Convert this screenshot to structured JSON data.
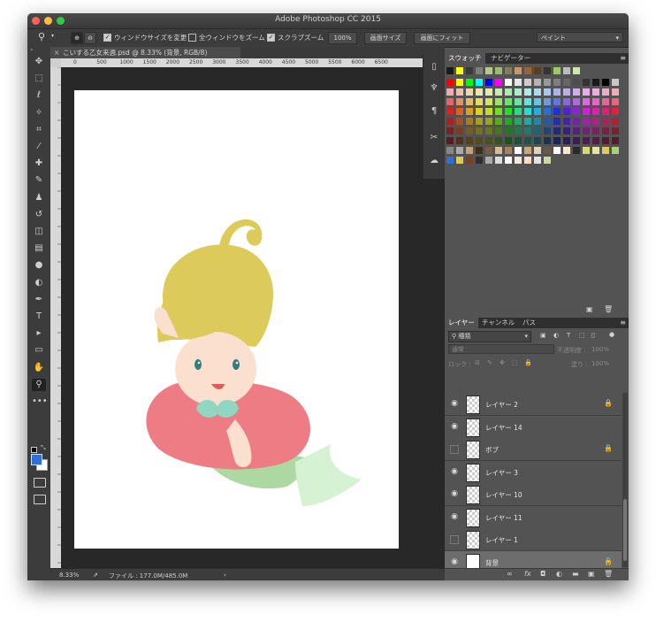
{
  "window": {
    "title": "Adobe Photoshop CC 2015"
  },
  "options_bar": {
    "resize_windows_label": "ウィンドウサイズを変更",
    "resize_windows_checked": true,
    "zoom_all_label": "全ウィンドウをズーム",
    "zoom_all_checked": false,
    "scrubby_zoom_label": "スクラブズーム",
    "scrubby_zoom_checked": true,
    "zoom_value": "100%",
    "fit_screen_label": "画面サイズ",
    "fill_screen_label": "画面にフィット",
    "workspace_value": "ペイント"
  },
  "document": {
    "tab_label": "こいする乙女来週.psd @ 8.33% (背景, RGB/8)",
    "close_glyph": "×",
    "ruler_ticks": [
      "0",
      "500",
      "1000",
      "1500",
      "2000",
      "2500",
      "3000",
      "3500",
      "4000",
      "4500",
      "5000",
      "5500",
      "6000",
      "6500"
    ]
  },
  "status": {
    "zoom": "8.33%",
    "file_info": "ファイル : 177.0M/485.0M",
    "arrow": "›"
  },
  "tools": [
    {
      "name": "move-tool",
      "glyph": "✥"
    },
    {
      "name": "marquee-tool",
      "glyph": "⬚"
    },
    {
      "name": "lasso-tool",
      "glyph": "ℓ"
    },
    {
      "name": "magic-wand-tool",
      "glyph": "✧"
    },
    {
      "name": "crop-tool",
      "glyph": "⌗"
    },
    {
      "name": "eyedropper-tool",
      "glyph": "⁄"
    },
    {
      "name": "healing-brush-tool",
      "glyph": "✚"
    },
    {
      "name": "brush-tool",
      "glyph": "✎"
    },
    {
      "name": "clone-stamp-tool",
      "glyph": "♟"
    },
    {
      "name": "history-brush-tool",
      "glyph": "↺"
    },
    {
      "name": "eraser-tool",
      "glyph": "◫"
    },
    {
      "name": "gradient-tool",
      "glyph": "▤"
    },
    {
      "name": "blur-tool",
      "glyph": "●"
    },
    {
      "name": "dodge-tool",
      "glyph": "◐"
    },
    {
      "name": "pen-tool",
      "glyph": "✒"
    },
    {
      "name": "type-tool",
      "glyph": "T"
    },
    {
      "name": "path-selection-tool",
      "glyph": "▸"
    },
    {
      "name": "rectangle-tool",
      "glyph": "▭"
    },
    {
      "name": "hand-tool",
      "glyph": "✋"
    },
    {
      "name": "zoom-tool",
      "glyph": "⚲"
    },
    {
      "name": "edit-toolbar",
      "glyph": "•••"
    }
  ],
  "swatches_panel": {
    "tabs": [
      "スウォッチ",
      "ナビゲーター"
    ]
  },
  "layers_panel": {
    "tabs": [
      "レイヤー",
      "チャンネル",
      "パス"
    ],
    "filter_label": "種類",
    "blend_mode": "通常",
    "opacity_label": "不透明度 :",
    "opacity_value": "100%",
    "lock_label": "ロック :",
    "fill_label": "塗り :",
    "fill_value": "100%",
    "layers": [
      {
        "name": "レイヤー 2",
        "visible": true,
        "locked": true,
        "active": false,
        "thumb": "check"
      },
      {
        "name": "レイヤー 14",
        "visible": true,
        "locked": false,
        "active": false,
        "thumb": "check"
      },
      {
        "name": "ボブ",
        "visible": false,
        "locked": true,
        "active": false,
        "thumb": "check"
      },
      {
        "name": "レイヤー 3",
        "visible": true,
        "locked": false,
        "active": false,
        "thumb": "check"
      },
      {
        "name": "レイヤー 10",
        "visible": true,
        "locked": false,
        "active": false,
        "thumb": "check"
      },
      {
        "name": "レイヤー 11",
        "visible": true,
        "locked": false,
        "active": false,
        "thumb": "check"
      },
      {
        "name": "レイヤー 1",
        "visible": false,
        "locked": false,
        "active": false,
        "thumb": "check"
      },
      {
        "name": "背景",
        "visible": true,
        "locked": true,
        "active": true,
        "thumb": "white"
      }
    ]
  },
  "colors": {
    "foreground": "#2f6fd6",
    "background": "#ffffff",
    "hair": "#dccb5a",
    "skin": "#fce0cf",
    "float_ring": "#ee7c84",
    "shell": "#8fd7c1",
    "tail": "#aed8a2",
    "fin": "#d5f3d2"
  }
}
